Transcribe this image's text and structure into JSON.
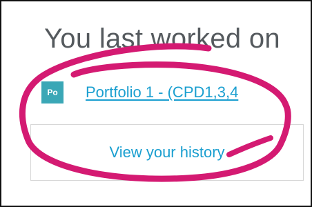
{
  "panel": {
    "title": "You last worked on"
  },
  "last_item": {
    "badge": "Po",
    "label": "Portfolio 1 - (CPD1,3,4"
  },
  "history_button": {
    "label": "View your history"
  },
  "colors": {
    "badge_bg": "#3aa7b6",
    "link": "#1a9fd0",
    "annotation": "#d41a72"
  },
  "annotation_icon": "hand-drawn-circle-highlight"
}
